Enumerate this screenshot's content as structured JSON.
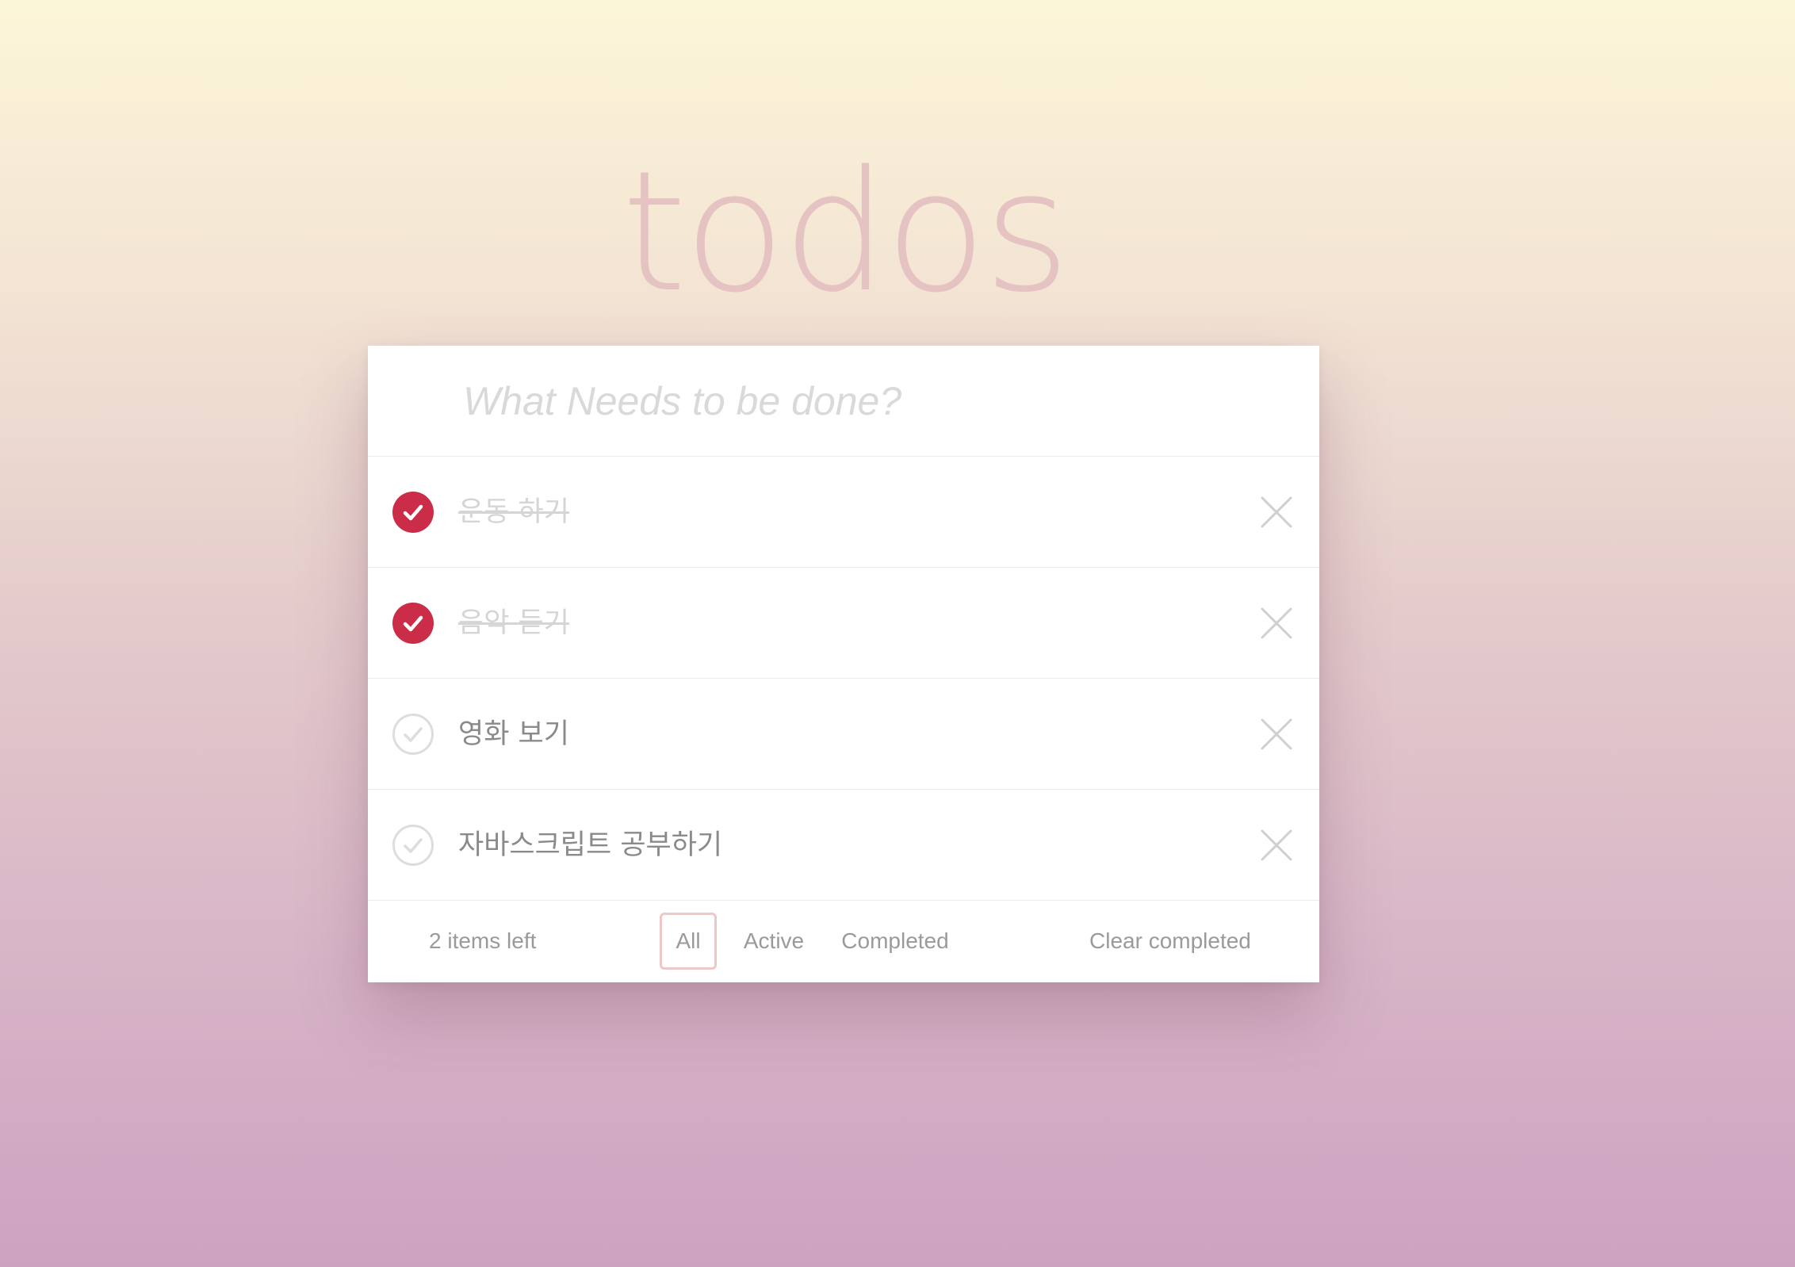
{
  "app": {
    "title": "todos"
  },
  "new_todo": {
    "placeholder": "What Needs to be done?",
    "value": ""
  },
  "todos": [
    {
      "label": "운동 하기",
      "completed": true
    },
    {
      "label": "음악 듣기",
      "completed": true
    },
    {
      "label": "영화 보기",
      "completed": false
    },
    {
      "label": "자바스크립트 공부하기",
      "completed": false
    }
  ],
  "footer": {
    "items_left": "2 items left",
    "filters": {
      "all": "All",
      "active": "Active",
      "completed": "Completed"
    },
    "selected_filter": "All",
    "clear_completed": "Clear completed"
  },
  "icons": {
    "check_done": "check-circle-filled-icon",
    "check_open": "check-circle-outline-icon",
    "destroy": "close-icon"
  },
  "colors": {
    "accent": "#cb2d48",
    "title": "#e6c3c3",
    "selected_filter_border": "#ecc8c8"
  }
}
